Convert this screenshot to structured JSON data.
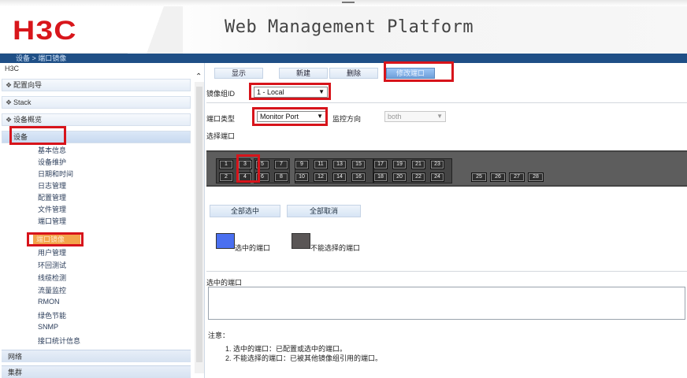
{
  "header": {
    "logo_text": "H3C",
    "platform_title": "Web Management Platform",
    "breadcrumb": "设备 > 端口镜像"
  },
  "sidebar": {
    "root_label": "H3C",
    "sections": [
      {
        "label": "配置向导"
      },
      {
        "label": "Stack"
      },
      {
        "label": "设备概览"
      },
      {
        "label": "设备"
      }
    ],
    "device_items": [
      "基本信息",
      "设备维护",
      "日期和时间",
      "日志管理",
      "配置管理",
      "文件管理",
      "端口管理",
      "端口镜像",
      "用户管理",
      "环回测试",
      "线缆检测",
      "流量监控",
      "RMON",
      "绿色节能",
      "SNMP",
      "接口统计信息"
    ],
    "bottom_sections": [
      "网络",
      "集群"
    ]
  },
  "tabs": [
    "显示",
    "新建",
    "删除",
    "修改端口"
  ],
  "form": {
    "mirror_group_label": "镜像组ID",
    "mirror_group_value": "1 - Local",
    "port_type_label": "端口类型",
    "port_type_value": "Monitor Port",
    "direction_label": "监控方向",
    "direction_value": "both",
    "select_port_label": "选择端口"
  },
  "ports": {
    "top_row": [
      "1",
      "3",
      "5",
      "7",
      "9",
      "11",
      "13",
      "15",
      "17",
      "19",
      "21",
      "23"
    ],
    "bottom_row": [
      "2",
      "4",
      "6",
      "8",
      "10",
      "12",
      "14",
      "16",
      "18",
      "20",
      "22",
      "24"
    ],
    "extra_ports": [
      "25",
      "26",
      "27",
      "28"
    ],
    "selected_port": "3"
  },
  "buttons": {
    "select_all": "全部选中",
    "deselect_all": "全部取消"
  },
  "legend": {
    "selected_label": "选中的端口",
    "unavailable_label": "不能选择的端口",
    "selected_color": "#4a6ff0",
    "unavailable_color": "#5a5656"
  },
  "selected_ports_label": "选中的端口",
  "notes": {
    "title": "注意：",
    "items": [
      "1.  选中的端口：已配置或选中的端口。",
      "2.  不能选择的端口：已被其他镜像组引用的端口。"
    ]
  },
  "highlight_color": "#d7141b"
}
